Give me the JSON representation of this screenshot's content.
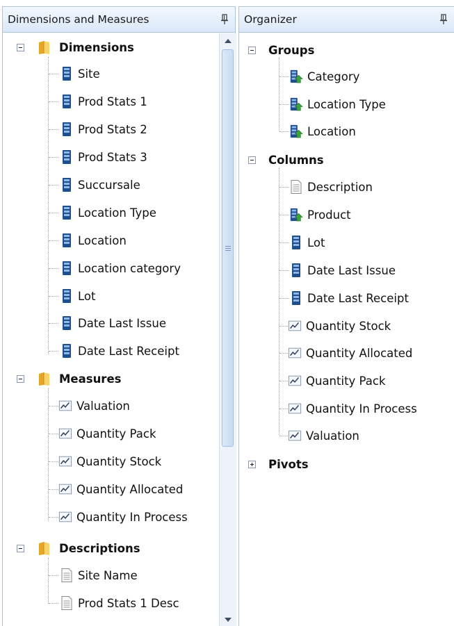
{
  "left_panel": {
    "title": "Dimensions and Measures",
    "groups": [
      {
        "label": "Dimensions",
        "items": [
          "Site",
          "Prod Stats 1",
          "Prod Stats 2",
          "Prod Stats 3",
          "Succursale",
          "Location Type",
          "Location",
          "Location category",
          "Lot",
          "Date Last Issue",
          "Date Last Receipt"
        ]
      },
      {
        "label": "Measures",
        "items": [
          "Valuation",
          "Quantity Pack",
          "Quantity Stock",
          "Quantity Allocated",
          "Quantity In Process"
        ]
      },
      {
        "label": "Descriptions",
        "items": [
          "Site Name",
          "Prod Stats 1 Desc"
        ]
      }
    ]
  },
  "right_panel": {
    "title": "Organizer",
    "groups": [
      {
        "label": "Groups",
        "items": [
          "Category",
          "Location Type",
          "Location"
        ]
      },
      {
        "label": "Columns",
        "items": [
          "Description",
          "Product",
          "Lot",
          "Date Last Issue",
          "Date Last Receipt",
          "Quantity Stock",
          "Quantity Allocated",
          "Quantity Pack",
          "Quantity In Process",
          "Valuation"
        ]
      },
      {
        "label": "Pivots",
        "items": []
      }
    ]
  },
  "icons": {
    "pin": "pin-icon",
    "folder": "folder-icon",
    "dimension": "dimension-icon",
    "grouped_dimension": "group-dimension-icon",
    "measure": "measure-chart-icon",
    "description": "document-icon",
    "expand": "expand-icon",
    "collapse": "collapse-icon"
  },
  "colors": {
    "header_bg": "#dae8f8",
    "border": "#a9c3e2",
    "dimension_blue": "#1f4e8c",
    "group_arrow_green": "#3aa53a",
    "folder_yellow": "#f2c14e"
  }
}
